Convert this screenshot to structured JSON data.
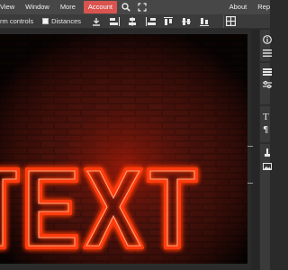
{
  "menubar": {
    "items": [
      {
        "label": "View"
      },
      {
        "label": "Window"
      },
      {
        "label": "More"
      },
      {
        "label": "Account"
      }
    ],
    "right_items": [
      {
        "label": "About"
      },
      {
        "label": "Rep"
      }
    ]
  },
  "options_bar": {
    "transform_controls_label": "rm controls",
    "distances_label": "Distances",
    "distances_checked": false
  },
  "canvas": {
    "text": "TEXT",
    "text_color": "#ff3a10",
    "glow_color": "#ff5a1a",
    "brick_color": "#3a1410"
  },
  "colors": {
    "accent": "#d9534f",
    "menubar_bg": "#474747",
    "panel_bg": "#3a3a3a"
  }
}
